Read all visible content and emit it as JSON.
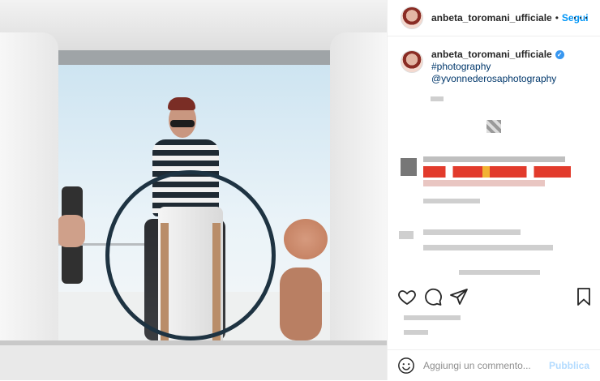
{
  "post": {
    "username": "anbeta_toromani_ufficiale",
    "follow_label": "Segui",
    "separator": "•",
    "more_label": "···",
    "caption": {
      "username": "anbeta_toromani_ufficiale",
      "hashtag": "#photography",
      "mention": "@yvonnederosaphotography"
    },
    "comment_placeholder": "Aggiungi un commento...",
    "publish_label": "Pubblica"
  },
  "icons": {
    "like": "heart-icon",
    "comment": "comment-icon",
    "share": "share-icon",
    "save": "bookmark-icon",
    "verified": "verified-badge-icon",
    "emoji": "emoji-icon"
  },
  "colors": {
    "accent": "#0095f6",
    "text": "#262626",
    "hashtag": "#00376b",
    "publish_disabled": "#b3dbff",
    "verified": "#3897f0"
  }
}
